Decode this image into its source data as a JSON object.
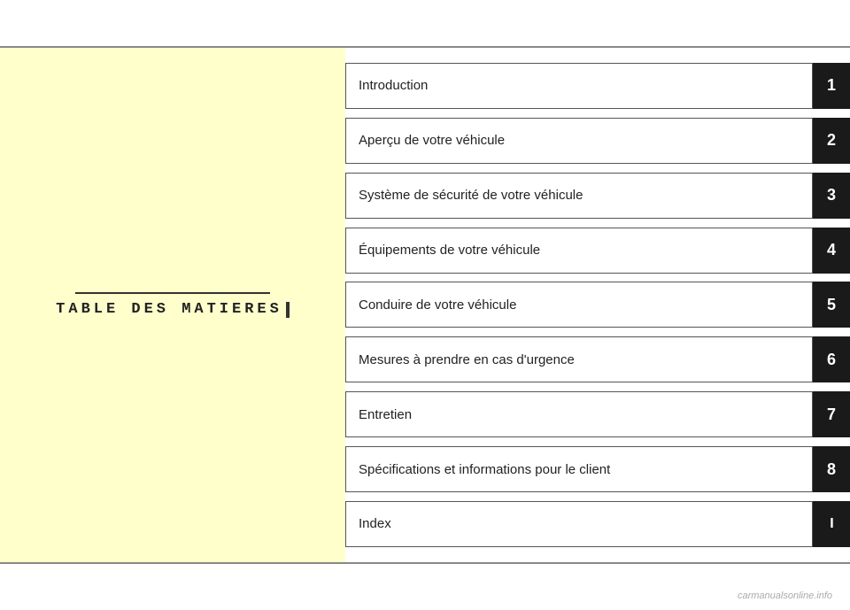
{
  "page": {
    "title": "TABLE DES MATIERES",
    "watermark": "carmanualsonline.info",
    "menu_items": [
      {
        "id": "intro",
        "label": "Introduction",
        "number": "1",
        "is_roman": false
      },
      {
        "id": "apercu",
        "label": "Aperçu de votre véhicule",
        "number": "2",
        "is_roman": false
      },
      {
        "id": "securite",
        "label": "Système de sécurité de votre véhicule",
        "number": "3",
        "is_roman": false
      },
      {
        "id": "equipements",
        "label": "Équipements de votre véhicule",
        "number": "4",
        "is_roman": false
      },
      {
        "id": "conduire",
        "label": "Conduire de votre véhicule",
        "number": "5",
        "is_roman": false
      },
      {
        "id": "mesures",
        "label": "Mesures à prendre en cas d'urgence",
        "number": "6",
        "is_roman": false
      },
      {
        "id": "entretien",
        "label": "Entretien",
        "number": "7",
        "is_roman": false
      },
      {
        "id": "specifications",
        "label": "Spécifications et informations pour le client",
        "number": "8",
        "is_roman": false
      },
      {
        "id": "index",
        "label": "Index",
        "number": "I",
        "is_roman": true
      }
    ]
  }
}
